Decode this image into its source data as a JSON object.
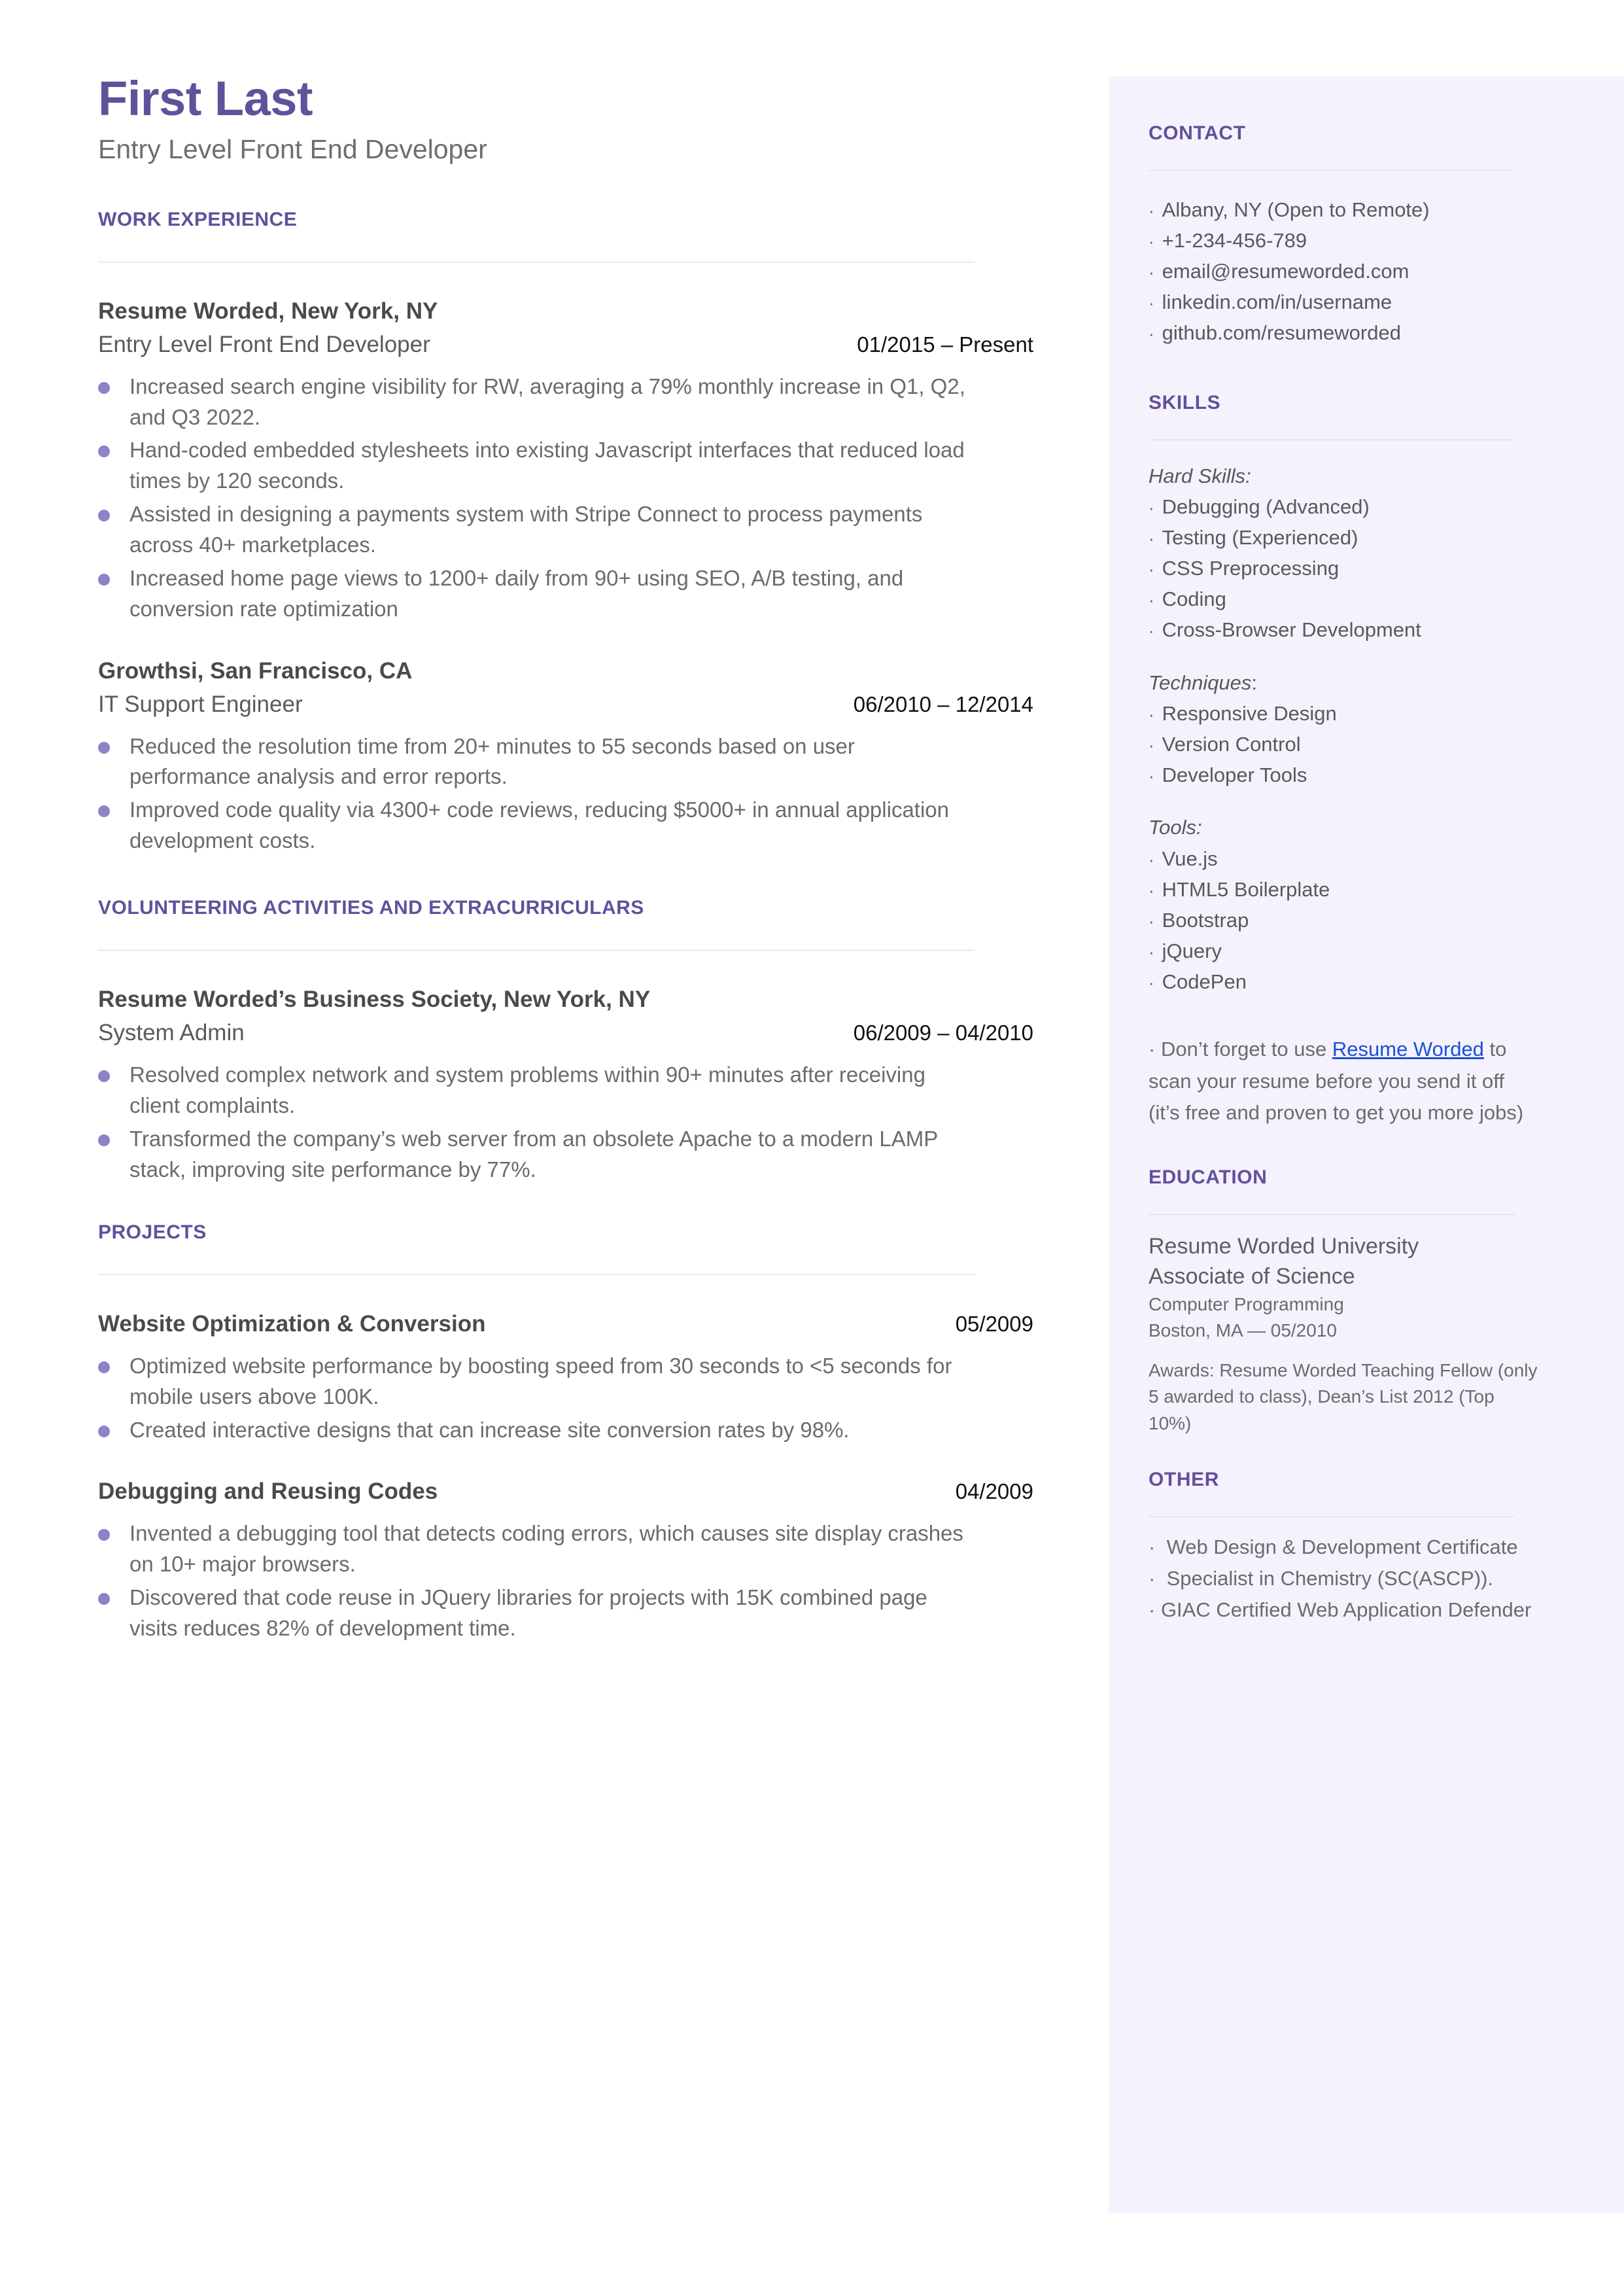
{
  "colors": {
    "accent_purple": "#61519b",
    "bullet_purple": "#9181c8",
    "sidebar_bg": "#f5f2fd",
    "link_blue": "#1a4fd6",
    "body_gray": "#6b6b6b"
  },
  "header": {
    "name": "First Last",
    "tagline": "Entry Level Front End Developer"
  },
  "work_experience": {
    "heading": "WORK EXPERIENCE",
    "jobs": [
      {
        "org": "Resume Worded, New York, NY",
        "title": "Entry Level Front End Developer",
        "date": "01/2015 – Present",
        "bullets": [
          "Increased search engine visibility for RW, averaging a 79% monthly increase in Q1, Q2, and Q3 2022.",
          "Hand-coded embedded stylesheets into existing Javascript interfaces that reduced load times by 120 seconds.",
          "Assisted in designing a payments system with Stripe Connect to process payments across 40+ marketplaces.",
          "Increased home page views to 1200+ daily from 90+ using SEO, A/B testing, and conversion rate optimization"
        ]
      },
      {
        "org": "Growthsi, San Francisco, CA",
        "title": "IT Support Engineer",
        "date": "06/2010 – 12/2014",
        "bullets": [
          "Reduced the resolution time from 20+ minutes to 55 seconds based on user performance analysis and error reports.",
          "Improved code quality via 4300+ code reviews, reducing $5000+ in annual application development costs."
        ]
      }
    ]
  },
  "volunteering": {
    "heading": "VOLUNTEERING ACTIVITIES AND EXTRACURRICULARS",
    "entries": [
      {
        "org": "Resume Worded’s Business Society, New York, NY",
        "title": "System Admin",
        "date": "06/2009 – 04/2010",
        "bullets": [
          "Resolved complex network and system problems within 90+ minutes after receiving client complaints.",
          "Transformed the company’s web server from an obsolete Apache to a modern LAMP stack, improving site performance by 77%."
        ]
      }
    ]
  },
  "projects": {
    "heading": "PROJECTS",
    "entries": [
      {
        "name": "Website Optimization & Conversion",
        "date": "05/2009",
        "bullets": [
          "Optimized website performance by boosting speed from 30 seconds to <5 seconds for mobile users above 100K.",
          "Created interactive designs that can increase site conversion rates by 98%."
        ]
      },
      {
        "name": "Debugging and Reusing Codes",
        "date": "04/2009",
        "bullets": [
          "Invented a debugging tool that detects coding errors, which causes site display crashes on 10+ major browsers.",
          "Discovered that code reuse in JQuery libraries for projects with 15K combined page visits reduces 82% of development time."
        ]
      }
    ]
  },
  "contact": {
    "heading": "CONTACT",
    "items": [
      "Albany, NY (Open to Remote)",
      "+1-234-456-789",
      "email@resumeworded.com",
      "linkedin.com/in/username",
      "github.com/resumeworded"
    ]
  },
  "skills": {
    "heading": "SKILLS",
    "groups": [
      {
        "label": "Hard Skills:",
        "label_italic_part": "Hard Skills:",
        "label_plain_part": "",
        "items": [
          "Debugging (Advanced)",
          "Testing (Experienced)",
          "CSS Preprocessing",
          "Coding",
          "Cross-Browser Development"
        ]
      },
      {
        "label": "Techniques:",
        "label_italic_part": "Techniques",
        "label_plain_part": ":",
        "items": [
          "Responsive Design",
          "Version Control",
          "Developer Tools"
        ]
      },
      {
        "label": "Tools:",
        "label_italic_part": "Tools:",
        "label_plain_part": "",
        "items": [
          "Vue.js",
          "HTML5 Boilerplate",
          "Bootstrap",
          "jQuery",
          "CodePen"
        ]
      }
    ],
    "promo": {
      "bullet": "·",
      "before_link": "Don’t forget to use ",
      "link_text": "Resume Worded",
      "after_link": " to scan your resume before you send it off (it’s free and proven to get you more jobs)"
    }
  },
  "education": {
    "heading": "EDUCATION",
    "school": "Resume Worded University",
    "degree": "Associate of Science",
    "field": "Computer Programming",
    "location_date": "Boston, MA — 05/2010",
    "awards": "Awards: Resume Worded Teaching Fellow (only 5 awarded to class), Dean’s List 2012 (Top 10%)"
  },
  "other": {
    "heading": "OTHER",
    "items": [
      "Web Design & Development Certificate",
      "Specialist in Chemistry (SC(ASCP)).",
      "GIAC Certified Web Application Defender"
    ]
  }
}
